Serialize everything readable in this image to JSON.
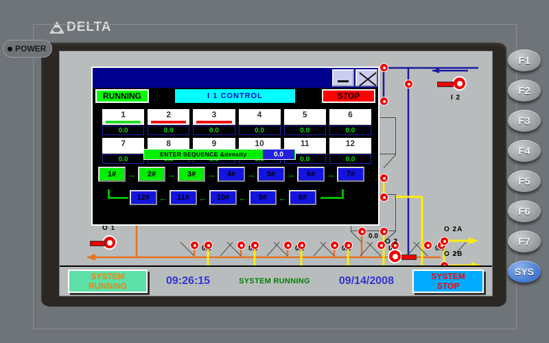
{
  "device": {
    "brand": "DELTA",
    "power_label": "POWER"
  },
  "function_keys": [
    {
      "label": "F1",
      "name": "f1"
    },
    {
      "label": "F2",
      "name": "f2"
    },
    {
      "label": "F3",
      "name": "f3"
    },
    {
      "label": "F4",
      "name": "f4"
    },
    {
      "label": "F5",
      "name": "f5"
    },
    {
      "label": "F6",
      "name": "f6"
    },
    {
      "label": "F7",
      "name": "f7"
    },
    {
      "label": "SYS",
      "name": "sys"
    }
  ],
  "app_window": {
    "running_badge": "RUNNING",
    "title": "I 1 CONTROL",
    "stop_badge": "STOP",
    "minimize_icon": "minimize-icon",
    "close_icon": "close-icon"
  },
  "num_grid": [
    {
      "id": "1",
      "value": "0.0",
      "bar": "green"
    },
    {
      "id": "2",
      "value": "0.0",
      "bar": "red"
    },
    {
      "id": "3",
      "value": "0.0",
      "bar": "red"
    },
    {
      "id": "4",
      "value": "0.0",
      "bar": "none"
    },
    {
      "id": "5",
      "value": "0.0",
      "bar": "none"
    },
    {
      "id": "6",
      "value": "0.0",
      "bar": "none"
    },
    {
      "id": "7",
      "value": "0.0",
      "bar": "none"
    },
    {
      "id": "8",
      "value": "0.0",
      "bar": "none"
    },
    {
      "id": "9",
      "value": "0.0",
      "bar": "none"
    },
    {
      "id": "10",
      "value": "0.0",
      "bar": "none"
    },
    {
      "id": "11",
      "value": "0.0",
      "bar": "none"
    },
    {
      "id": "12",
      "value": "0.0",
      "bar": "none"
    }
  ],
  "sequence_entry": {
    "label": "ENTER SEQUENCE &density",
    "value": "0.0"
  },
  "sequence_row1": [
    {
      "label": "1#",
      "state": "green"
    },
    {
      "label": "2#",
      "state": "green"
    },
    {
      "label": "3#",
      "state": "green"
    },
    {
      "label": "4#",
      "state": "blue"
    },
    {
      "label": "5#",
      "state": "blue"
    },
    {
      "label": "6#",
      "state": "blue"
    },
    {
      "label": "7#",
      "state": "blue"
    }
  ],
  "sequence_row2": [
    {
      "label": "12#",
      "state": "blue"
    },
    {
      "label": "11#",
      "state": "blue"
    },
    {
      "label": "10#",
      "state": "blue"
    },
    {
      "label": "9#",
      "state": "blue"
    },
    {
      "label": "8#",
      "state": "blue"
    }
  ],
  "arrow_glyph": "→",
  "arrow_glyph_left": "←",
  "process": {
    "silo_6_name": "6#",
    "silo_6_value": "0.0",
    "silo_12_name": "12#",
    "silo_12_value": "0.0",
    "bottom_hopper_values": [
      "0.0",
      "0.0",
      "0.0",
      "0.0",
      "0.0",
      "0.0"
    ],
    "tag_i2": "I 2",
    "tag_o1": "O 1",
    "tag_o2": "O 2",
    "tag_o2a": "O 2A",
    "tag_o2b": "O 2B"
  },
  "bottom_bar": {
    "system_running_button_line1": "SYSTEM",
    "system_running_button_line2": "RUNNING",
    "time": "09:26:15",
    "status": "SYSTEM RUNNING",
    "date": "09/14/2008",
    "system_stop_button_line1": "SYSTEM",
    "system_stop_button_line2": "STOP"
  },
  "colors": {
    "running_green": "#00ff00",
    "stop_red": "#ff0000",
    "title_cyan": "#00ffff",
    "titlebar_blue": "#00008f",
    "valve_red": "#ee0000",
    "pipe_orange": "#e8721e",
    "pipe_yellow": "#ffee00",
    "pipe_blue": "#1a1a9e",
    "pipe_teal": "#0f7a7a"
  }
}
